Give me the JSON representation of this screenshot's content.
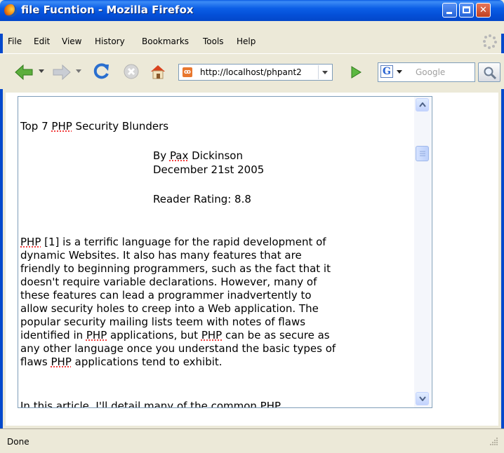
{
  "window": {
    "title": "file Fucntion - Mozilla Firefox",
    "title_bar_color": "#0a5ce3",
    "close_button_color": "#c0401f"
  },
  "menu": {
    "items": [
      {
        "label": "File",
        "key": "F"
      },
      {
        "label": "Edit",
        "key": "E"
      },
      {
        "label": "View",
        "key": "V"
      },
      {
        "label": "History",
        "key": "s"
      },
      {
        "label": "Bookmarks",
        "key": "B"
      },
      {
        "label": "Tools",
        "key": "T"
      },
      {
        "label": "Help",
        "key": "H"
      }
    ]
  },
  "toolbar": {
    "icons": [
      "back-arrow-icon",
      "forward-arrow-icon",
      "reload-icon",
      "stop-icon",
      "home-icon",
      "favicon-icon",
      "go-arrow-icon",
      "google-icon",
      "search-icon"
    ],
    "address": "http://localhost/phpant2",
    "search_placeholder": "Google",
    "google_glyph": "G"
  },
  "article": {
    "title_prefix": "Top 7 ",
    "title_php": "PHP",
    "title_suffix": " Security Blunders",
    "byline_prefix": "By ",
    "byline_name_first": "Pax",
    "byline_name_last": " Dickinson",
    "date": "December 21st 2005",
    "rating": "Reader Rating: 8.8",
    "para1_lines": [
      "PHP [1] is a terrific language for the rapid development of",
      "dynamic Websites. It also has many features that are",
      "friendly to beginning programmers, such as the fact that it",
      "doesn't require variable declarations. However, many of",
      "these features can lead a programmer inadvertently to",
      "allow security holes to creep into a Web application. The",
      "popular security mailing lists teem with notes of flaws",
      "identified in PHP applications, but PHP can be as secure as",
      "any other language once you understand the basic types of",
      "flaws PHP applications tend to exhibit."
    ],
    "para2_line": "In this article, I'll detail many of the common PHP"
  },
  "status": {
    "text": "Done"
  }
}
